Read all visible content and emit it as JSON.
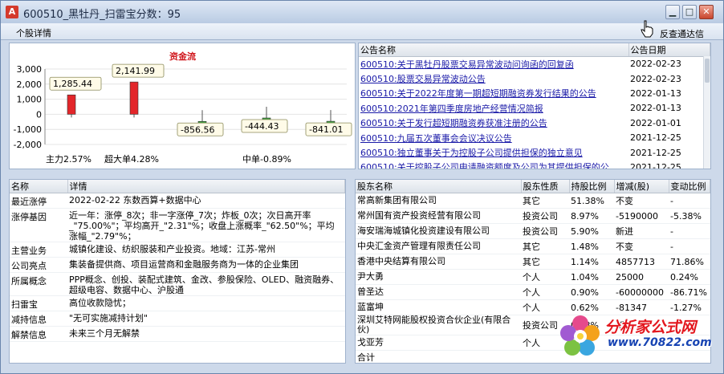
{
  "window": {
    "title": "600510_黑牡丹_扫雷宝分数：95",
    "app_icon": "A"
  },
  "menu": {
    "left": "个股详情",
    "right": "反查通达信"
  },
  "chart_data": {
    "type": "bar",
    "title": "资金流",
    "yticks": [
      "3,000",
      "2,000",
      "1,000",
      "0",
      "-1,000",
      "-2,000"
    ],
    "ylim": [
      -2000,
      3000
    ],
    "values": [
      1285.44,
      2141.99,
      -856.56,
      -444.43,
      -841.01
    ],
    "value_labels": [
      "1,285.44",
      "2,141.99",
      "-856.56",
      "-444.43",
      "-841.01"
    ],
    "category_labels": [
      "主力2.57%",
      "超大单4.28%",
      "中单-0.89%"
    ],
    "colors": [
      "#e3262a",
      "#e3262a",
      "#3fa23f",
      "#3fa23f",
      "#3fa23f"
    ]
  },
  "announcements": {
    "headers": [
      "公告名称",
      "公告日期"
    ],
    "rows": [
      [
        "600510:关于黑牡丹股票交易异常波动问询函的回复函",
        "2022-02-23"
      ],
      [
        "600510:股票交易异常波动公告",
        "2022-02-23"
      ],
      [
        "600510:关于2022年度第一期超短期融资券发行结果的公告",
        "2022-01-13"
      ],
      [
        "600510:2021年第四季度房地产经营情况简报",
        "2022-01-13"
      ],
      [
        "600510:关于发行超短期融资券获准注册的公告",
        "2022-01-01"
      ],
      [
        "600510:九届五次董事会会议决议公告",
        "2021-12-25"
      ],
      [
        "600510:独立董事关于为控股子公司提供担保的独立意见",
        "2021-12-25"
      ],
      [
        "600510:关于控股子公司申请融资额度及公司为其提供担保的公",
        "2021-12-25"
      ]
    ]
  },
  "details": {
    "headers": [
      "名称",
      "详情"
    ],
    "rows": [
      [
        "最近涨停",
        "2022-02-22 东数西算+数据中心"
      ],
      [
        "涨停基因",
        "近一年：涨停_8次；非一字涨停_7次；炸板_0次；次日高开率_\"75.00%\"；平均高开_\"2.31\"%；收盘上涨概率_\"62.50\"%；平均涨幅_\"2.79\"%；"
      ],
      [
        "主营业务",
        "城镇化建设、纺织服装和产业投资。地域：江苏-常州"
      ],
      [
        "公司亮点",
        "集装备提供商、项目运营商和金融服务商为一体的企业集团"
      ],
      [
        "所属概念",
        "PPP概念、创投、装配式建筑、金改、参股保险、OLED、融资融券、超级电容、数据中心、沪股通"
      ],
      [
        "扫雷宝",
        "高位收款隐忧；"
      ],
      [
        "减持信息",
        "\"无可实施减持计划\""
      ],
      [
        "解禁信息",
        "未来三个月无解禁"
      ]
    ]
  },
  "holders": {
    "headers": [
      "股东名称",
      "股东性质",
      "持股比例",
      "增减(股)",
      "变动比例"
    ],
    "rows": [
      [
        "常高新集团有限公司",
        "其它",
        "51.38%",
        "不变",
        "-"
      ],
      [
        "常州国有资产投资经营有限公司",
        "投资公司",
        "8.97%",
        "-5190000",
        "-5.38%"
      ],
      [
        "海安瑞海城镇化投资建设有限公司",
        "投资公司",
        "5.90%",
        "新进",
        "-"
      ],
      [
        "中央汇金资产管理有限责任公司",
        "其它",
        "1.48%",
        "不变",
        "-"
      ],
      [
        "香港中央结算有限公司",
        "其它",
        "1.14%",
        "4857713",
        "71.86%"
      ],
      [
        "尹大勇",
        "个人",
        "1.04%",
        "25000",
        "0.24%"
      ],
      [
        "曾圣达",
        "个人",
        "0.90%",
        "-60000000",
        "-86.71%"
      ],
      [
        "蓝富坤",
        "个人",
        "0.62%",
        "-81347",
        "-1.27%"
      ],
      [
        "深圳艾特网能股权投资合伙企业(有限合伙)",
        "投资公司",
        "0.38%",
        "新进",
        "-"
      ],
      [
        "戈亚芳",
        "个人",
        "",
        "",
        ""
      ],
      [
        "合计",
        "",
        "",
        "",
        ""
      ]
    ]
  },
  "watermark": {
    "brand": "分析家公式网",
    "url": "www.70822.com"
  }
}
